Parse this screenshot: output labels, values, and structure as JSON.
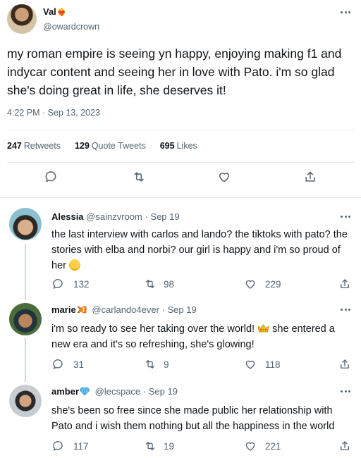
{
  "main_tweet": {
    "display_name": "Val",
    "name_decoration": "❤️‍🔥",
    "handle": "@owardcrown",
    "text": "my roman empire is seeing yn happy, enjoying making f1 and indycar content and seeing her in love with Pato. i'm so glad she's doing great in life, she deserves it!",
    "timestamp": "4:22 PM · Sep 13, 2023",
    "stats": {
      "retweets_count": "247",
      "retweets_label": "Retweets",
      "quotes_count": "129",
      "quotes_label": "Quote Tweets",
      "likes_count": "695",
      "likes_label": "Likes"
    }
  },
  "replies": [
    {
      "display_name": "Alessia",
      "handle": "@sainzvroom",
      "date": "· Sep 19",
      "text": "the last interview with carlos and lando? the tiktoks with pato? the stories with elba and norbi? our girl is happy and i'm so proud of her",
      "emoji": "crying-face",
      "reply_count": "132",
      "retweet_count": "98",
      "like_count": "229"
    },
    {
      "display_name": "marie",
      "badge": "orange-fish-emoji",
      "handle": "@carlando4ever",
      "date": "· Sep 19",
      "text_part1": "i'm so ready to see her taking over the world!",
      "text_part2": " she entered a new era and it's so refreshing, she's glowing!",
      "emoji": "crown",
      "reply_count": "31",
      "retweet_count": "9",
      "like_count": "118"
    },
    {
      "display_name": "amber",
      "badge": "gem-emoji",
      "handle": "@lecspace",
      "date": "· Sep 19",
      "text": "she's been so free since she made public her relationship with Pato and i wish them nothing but all the happiness in the world",
      "reply_count": "117",
      "retweet_count": "19",
      "like_count": "221"
    }
  ],
  "colors": {
    "text_primary": "#0f1419",
    "text_secondary": "#536471",
    "divider": "#e6eaed",
    "thread_line": "#cfd9de"
  }
}
